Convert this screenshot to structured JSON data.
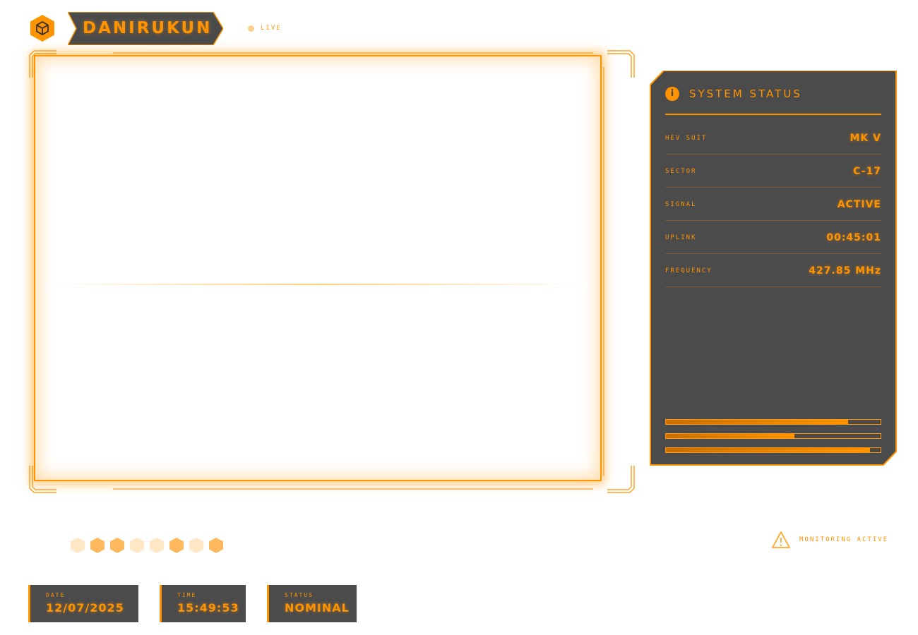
{
  "header": {
    "brand": "DANIRUKUN",
    "live_label": "LIVE",
    "logo_icon": "cube-icon",
    "live_icon": "live-dot-icon"
  },
  "viewport": {
    "frame_icon": "corner-bracket-icon"
  },
  "status_panel": {
    "title": "SYSTEM STATUS",
    "title_icon": "info-icon",
    "info_glyph": "i",
    "rows": [
      {
        "label": "HEV SUIT",
        "value": "MK V"
      },
      {
        "label": "SECTOR",
        "value": "C-17"
      },
      {
        "label": "SIGNAL",
        "value": "ACTIVE"
      },
      {
        "label": "UPLINK",
        "value": "00:45:01"
      },
      {
        "label": "FREQUENCY",
        "value": "427.85 MHz"
      }
    ],
    "bars": [
      0.85,
      0.6,
      0.95
    ]
  },
  "hex_indicators": [
    {
      "state": "dim"
    },
    {
      "state": "lit"
    },
    {
      "state": "lit"
    },
    {
      "state": "dim"
    },
    {
      "state": "dim"
    },
    {
      "state": "lit"
    },
    {
      "state": "dim"
    },
    {
      "state": "lit"
    }
  ],
  "monitoring": {
    "text": "MONITORING ACTIVE",
    "icon": "warning-icon"
  },
  "footer": {
    "date": {
      "label": "DATE",
      "value": "12/07/2025"
    },
    "time": {
      "label": "TIME",
      "value": "15:49:53"
    },
    "status": {
      "label": "STATUS",
      "value": "NOMINAL"
    }
  },
  "colors": {
    "accent": "#ff9400",
    "panel_bg": "#4b4b4b",
    "hex_lit": "#ffb95c",
    "hex_dim": "#ffe6c4"
  }
}
